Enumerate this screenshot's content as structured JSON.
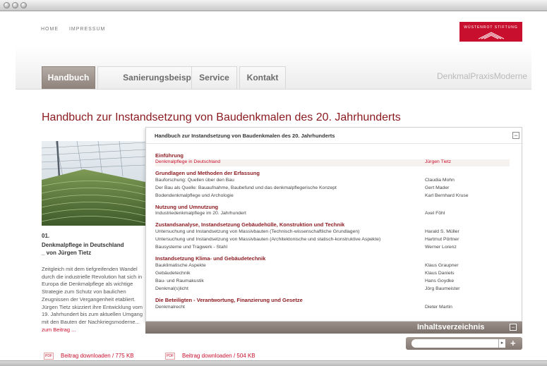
{
  "colors": {
    "brand_red": "#c8102e",
    "title_red": "#8b1a1f",
    "tab_active": "#9a8f88"
  },
  "nav": {
    "home": "HOME",
    "impressum": "IMPRESSUM"
  },
  "logo": {
    "text": "WÜSTENROT STIFTUNG"
  },
  "tabs": [
    {
      "label": "Handbuch",
      "active": true
    },
    {
      "label": "Sanierungsbeispiele",
      "active": false
    },
    {
      "label": "Service",
      "active": false
    },
    {
      "label": "Kontakt",
      "active": false
    }
  ],
  "brand": "DenkmalPraxisModerne",
  "page_title": "Handbuch zur Instandsetzung von Baudenkmalen des 20. Jahrhunderts",
  "article": {
    "number": "01.",
    "title_line1": "Denkmalpflege in Deutschland",
    "title_line2": "_ von Jürgen Tietz",
    "text": "Zeitgleich mit dem tiefgreifenden Wandel durch die industrielle Revolution hat sich in Europa die Denkmalpflege als wichtige Strategie zum Schutz von baulichen Zeugnissen der Vergangenheit etabliert. Jürgen Tietz skizziert ihre Entwicklung vom 19. Jahrhundert bis zum aktuellen Umgang mit den Bauten der Nachkriegsmoderne...",
    "more": "zum Beitrag ..."
  },
  "downloads": [
    {
      "icon": "PDF",
      "label": "Beitrag downloaden / 775 KB"
    },
    {
      "icon": "PDF",
      "label": "Beitrag downloaden / 504 KB"
    }
  ],
  "toc": {
    "header": "Handbuch zur Instandsetzung von Baudenkmalen des 20. Jahrhunderts",
    "collapse_label": "−",
    "sections": [
      {
        "title": "Einführung",
        "entries": [
          {
            "title": "Denkmalpflege in Deutschland",
            "author": "Jürgen Tietz",
            "active": true
          }
        ]
      },
      {
        "title": "Grundlagen und Methoden der Erfassung",
        "entries": [
          {
            "title": "Bauforschung: Quellen über den Bau",
            "author": "Claudia Mohn"
          },
          {
            "title": "Der Bau als Quelle: Bauaufnahme, Baubefund und das denkmalpflegerische Konzept",
            "author": "Gert Mader"
          },
          {
            "title": "Bodendenkmalpflege und Archologie",
            "author": "Karl Bernhard Kruse"
          }
        ]
      },
      {
        "title": "Nutzung und Umnutzung",
        "entries": [
          {
            "title": "Industriedenkmalpflege im 20. Jahrhundert",
            "author": "Axel Föhl"
          }
        ]
      },
      {
        "title": "Zustandsanalyse, Instandsetzung Gebäudehülle, Konstruktion und Technik",
        "entries": [
          {
            "title": "Untersuchung und Instandsetzung von Massivbauten (Technisch-wissenschaftliche Grundlagen)",
            "author": "Harald S. Müller"
          },
          {
            "title": "Untersuchung und Instandsetzung von Massivbauten (Architektonische und statisch-konstruktive Aspekte)",
            "author": "Hartmut Pörtner"
          },
          {
            "title": "Bausysteme und Tragwerk - Stahl",
            "author": "Werner Lorenz"
          }
        ]
      },
      {
        "title": "Instandsetzung Klima- und Gebäudetechnik",
        "entries": [
          {
            "title": "Bauklimatische Aspekte",
            "author": "Klaus Graupner"
          },
          {
            "title": "Gebäudetechnik",
            "author": "Klaus Daniels"
          },
          {
            "title": "Bau- und Raumakustik",
            "author": "Hans Goydke"
          },
          {
            "title": "Denkmal(s)licht",
            "author": "Jörg Baumeister"
          }
        ]
      },
      {
        "title": "Die Beteiligten - Verantwortung, Finanzierung und Gesetze",
        "entries": [
          {
            "title": "Denkmalrecht",
            "author": "Dieter Martin"
          }
        ]
      }
    ]
  },
  "toc_bar": {
    "label": "Inhaltsverzeichnis",
    "collapse_label": "−"
  },
  "search": {
    "value": "",
    "go_label": "▸",
    "add_label": "+"
  }
}
